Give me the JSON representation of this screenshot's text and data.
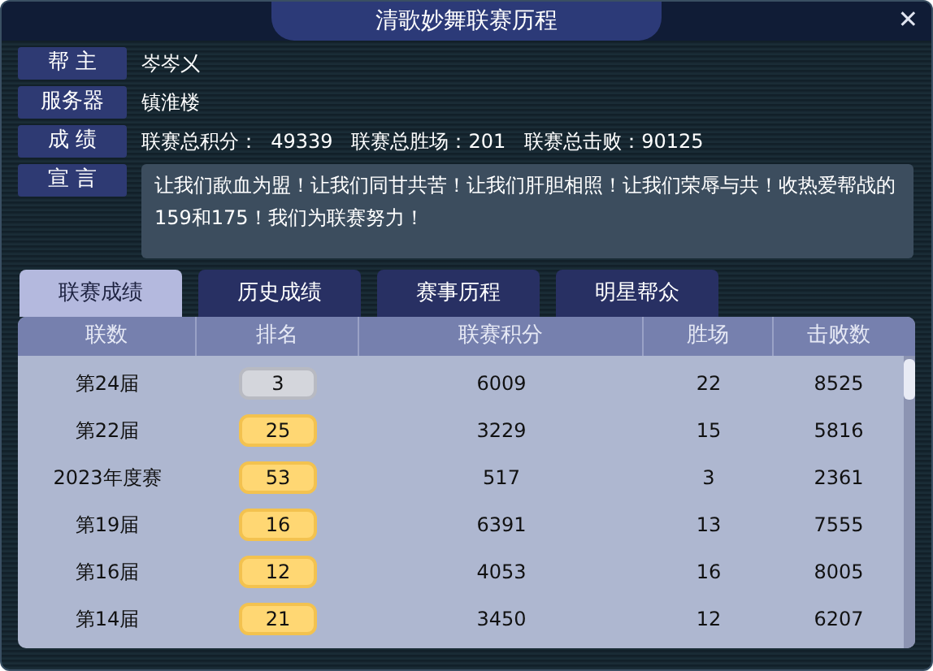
{
  "window": {
    "title": "清歌妙舞联赛历程",
    "close": "✕"
  },
  "info": [
    {
      "label": "帮 主",
      "value": "岑岑㐅"
    },
    {
      "label": "服务器",
      "value": "镇淮楼"
    },
    {
      "label": "成 绩",
      "value": "联赛总积分：  49339   联赛总胜场：201   联赛总击败：90125"
    }
  ],
  "motto": {
    "label": "宣 言",
    "text": "让我们歃血为盟！让我们同甘共苦！让我们肝胆相照！让我们荣辱与共！收热爱帮战的159和175！我们为联赛努力！"
  },
  "tabs": [
    {
      "label": "联赛成绩",
      "selected": true
    },
    {
      "label": "历史成绩",
      "selected": false
    },
    {
      "label": "赛事历程",
      "selected": false
    },
    {
      "label": "明星帮众",
      "selected": false
    }
  ],
  "table": {
    "columns": [
      "联数",
      "排名",
      "联赛积分",
      "胜场",
      "击败数"
    ],
    "rows": [
      {
        "season": "第24届",
        "rank": "3",
        "kind": "silver",
        "points": "6009",
        "wins": "22",
        "defeats": "8525"
      },
      {
        "season": "第22届",
        "rank": "25",
        "kind": "gold",
        "points": "3229",
        "wins": "15",
        "defeats": "5816"
      },
      {
        "season": "2023年度赛",
        "rank": "53",
        "kind": "gold",
        "points": "517",
        "wins": "3",
        "defeats": "2361"
      },
      {
        "season": "第19届",
        "rank": "16",
        "kind": "gold",
        "points": "6391",
        "wins": "13",
        "defeats": "7555"
      },
      {
        "season": "第16届",
        "rank": "12",
        "kind": "gold",
        "points": "4053",
        "wins": "16",
        "defeats": "8005"
      },
      {
        "season": "第14届",
        "rank": "21",
        "kind": "gold",
        "points": "3450",
        "wins": "12",
        "defeats": "6207"
      }
    ]
  }
}
